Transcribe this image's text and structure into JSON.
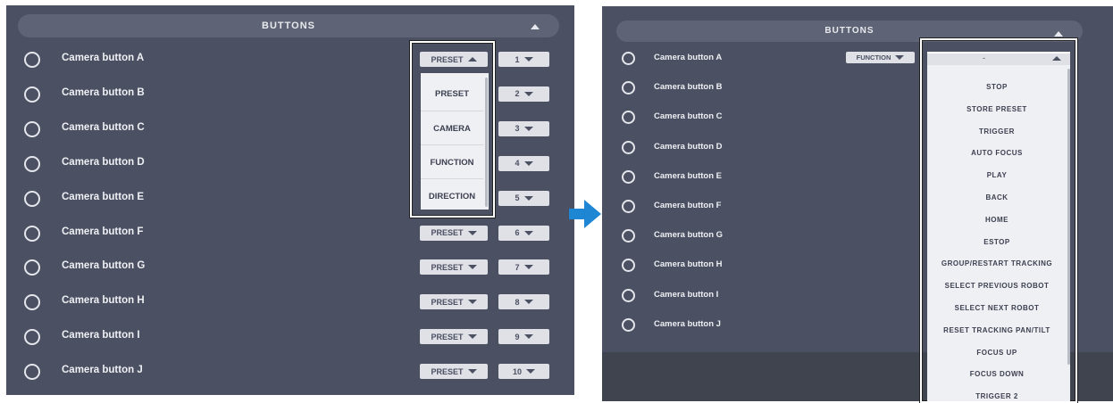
{
  "left": {
    "header": "BUTTONS",
    "rows": [
      {
        "label": "Camera button A",
        "type": "PRESET",
        "num": "1"
      },
      {
        "label": "Camera button B",
        "type": "PRESET",
        "num": "2"
      },
      {
        "label": "Camera button C",
        "type": "PRESET",
        "num": "3"
      },
      {
        "label": "Camera button D",
        "type": "PRESET",
        "num": "4"
      },
      {
        "label": "Camera button E",
        "type": "PRESET",
        "num": "5"
      },
      {
        "label": "Camera button F",
        "type": "PRESET",
        "num": "6"
      },
      {
        "label": "Camera button G",
        "type": "PRESET",
        "num": "7"
      },
      {
        "label": "Camera button H",
        "type": "PRESET",
        "num": "8"
      },
      {
        "label": "Camera button I",
        "type": "PRESET",
        "num": "9"
      },
      {
        "label": "Camera button J",
        "type": "PRESET",
        "num": "10"
      }
    ],
    "menu_options": [
      "PRESET",
      "CAMERA",
      "FUNCTION",
      "DIRECTION"
    ]
  },
  "right": {
    "header": "BUTTONS",
    "rows": [
      {
        "label": "Camera button A"
      },
      {
        "label": "Camera button B"
      },
      {
        "label": "Camera button C"
      },
      {
        "label": "Camera button D"
      },
      {
        "label": "Camera button E"
      },
      {
        "label": "Camera button F"
      },
      {
        "label": "Camera button G"
      },
      {
        "label": "Camera button H"
      },
      {
        "label": "Camera button I"
      },
      {
        "label": "Camera button J"
      }
    ],
    "type_value": "FUNCTION",
    "function_value": "-",
    "function_options": [
      "STOP",
      "STORE PRESET",
      "TRIGGER",
      "AUTO FOCUS",
      "PLAY",
      "BACK",
      "HOME",
      "ESTOP",
      "GROUP/RESTART TRACKING",
      "SELECT PREVIOUS ROBOT",
      "SELECT NEXT ROBOT",
      "RESET TRACKING PAN/TILT",
      "FOCUS UP",
      "FOCUS DOWN",
      "TRIGGER 2"
    ]
  },
  "colors": {
    "panel": "#4b5062",
    "header": "#5e6475",
    "dropdown": "#dfe1e7",
    "arrow": "#1f86d3"
  },
  "icons": [
    "radio-icon",
    "chevron-up-icon",
    "caret-down-icon",
    "caret-up-icon",
    "arrow-right-icon"
  ]
}
